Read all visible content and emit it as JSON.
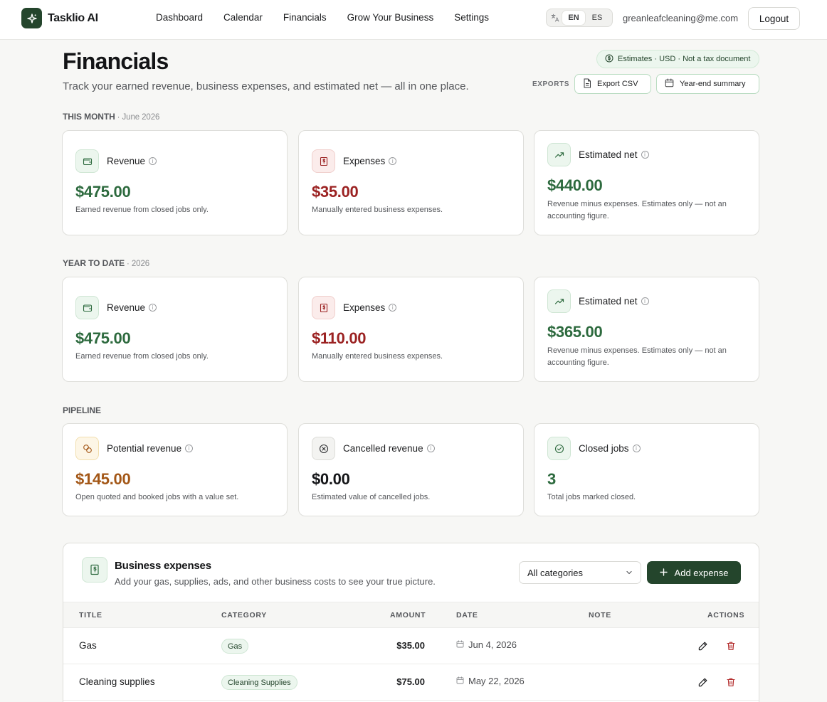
{
  "app": {
    "name": "Tasklio AI"
  },
  "nav": [
    {
      "label": "Dashboard"
    },
    {
      "label": "Calendar"
    },
    {
      "label": "Financials"
    },
    {
      "label": "Grow Your Business"
    },
    {
      "label": "Settings"
    }
  ],
  "lang": {
    "active": "EN",
    "other": "ES",
    "icon": "translate-icon"
  },
  "user": {
    "email": "greanleafcleaning@me.com",
    "logout_label": "Logout"
  },
  "page": {
    "title": "Financials",
    "subtitle": "Track your earned revenue, business expenses, and estimated net — all in one place.",
    "pill": "Estimates · USD · Not a tax document",
    "exports_label": "EXPORTS",
    "export_csv": "Export CSV",
    "year_end": "Year-end summary"
  },
  "this_month": {
    "label": "THIS MONTH",
    "sub": "· June 2026",
    "cards": [
      {
        "title": "Revenue",
        "value": "$475.00",
        "desc": "Earned revenue from closed jobs only.",
        "icon": "wallet-icon"
      },
      {
        "title": "Expenses",
        "value": "$35.00",
        "desc": "Manually entered business expenses.",
        "icon": "receipt-icon"
      },
      {
        "title": "Estimated net",
        "value": "$440.00",
        "desc": "Revenue minus expenses. Estimates only — not an accounting figure.",
        "icon": "trending-up-icon"
      }
    ]
  },
  "ytd": {
    "label": "YEAR TO DATE",
    "sub": "· 2026",
    "cards": [
      {
        "title": "Revenue",
        "value": "$475.00",
        "desc": "Earned revenue from closed jobs only.",
        "icon": "wallet-icon"
      },
      {
        "title": "Expenses",
        "value": "$110.00",
        "desc": "Manually entered business expenses.",
        "icon": "receipt-icon"
      },
      {
        "title": "Estimated net",
        "value": "$365.00",
        "desc": "Revenue minus expenses. Estimates only — not an accounting figure.",
        "icon": "trending-up-icon"
      }
    ]
  },
  "pipeline": {
    "label": "PIPELINE",
    "cards": [
      {
        "title": "Potential revenue",
        "value": "$145.00",
        "desc": "Open quoted and booked jobs with a value set.",
        "icon": "coins-icon"
      },
      {
        "title": "Cancelled revenue",
        "value": "$0.00",
        "desc": "Estimated value of cancelled jobs.",
        "icon": "x-circle-icon"
      },
      {
        "title": "Closed jobs",
        "value": "3",
        "desc": "Total jobs marked closed.",
        "icon": "check-circle-icon"
      }
    ]
  },
  "expenses": {
    "title": "Business expenses",
    "subtitle": "Add your gas, supplies, ads, and other business costs to see your true picture.",
    "filter": "All categories",
    "add_label": "Add expense",
    "columns": [
      "TITLE",
      "CATEGORY",
      "AMOUNT",
      "DATE",
      "NOTE",
      "ACTIONS"
    ],
    "rows": [
      {
        "title": "Gas",
        "category": "Gas",
        "amount": "$35.00",
        "date": "Jun 4, 2026",
        "note": ""
      },
      {
        "title": "Cleaning supplies",
        "category": "Cleaning Supplies",
        "amount": "$75.00",
        "date": "May 22, 2026",
        "note": ""
      }
    ]
  },
  "colors": {
    "brand": "#24452c",
    "positive": "#2d6a3e",
    "negative": "#9b2222",
    "warning": "#a35717"
  }
}
